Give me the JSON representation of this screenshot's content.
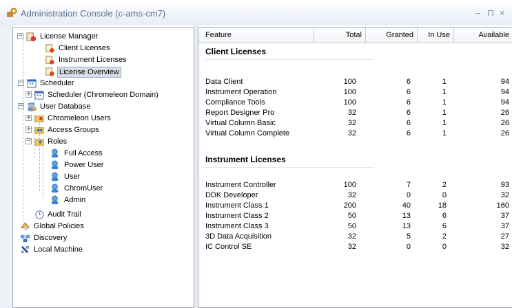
{
  "window": {
    "title": "Administration Console (c-ams-cm7)",
    "controls": {
      "minimize": "–",
      "restore": "⊓",
      "close": "×"
    }
  },
  "tree": [
    {
      "label": "License Manager",
      "icon": "license-manager-icon",
      "expander": "−"
    },
    {
      "label": "Client Licenses",
      "icon": "license-icon"
    },
    {
      "label": "Instrument Licenses",
      "icon": "license-icon"
    },
    {
      "label": "License Overview",
      "icon": "license-icon",
      "selected": true
    },
    {
      "label": "Scheduler",
      "icon": "scheduler-icon",
      "expander": "−"
    },
    {
      "label": "Scheduler (Chromeleon Domain)",
      "icon": "scheduler-icon",
      "expander": "+"
    },
    {
      "label": "User Database",
      "icon": "user-database-icon",
      "expander": "−"
    },
    {
      "label": "Chromeleon Users",
      "icon": "users-folder-icon",
      "expander": "+"
    },
    {
      "label": "Access Groups",
      "icon": "groups-folder-icon",
      "expander": "+"
    },
    {
      "label": "Roles",
      "icon": "roles-folder-icon",
      "expander": "−"
    },
    {
      "label": "Full Access",
      "icon": "role-icon"
    },
    {
      "label": "Power User",
      "icon": "role-icon"
    },
    {
      "label": "User",
      "icon": "role-icon"
    },
    {
      "label": "ChromUser",
      "icon": "role-icon"
    },
    {
      "label": "Admin",
      "icon": "role-icon"
    },
    {
      "label": "Audit Trail",
      "icon": "audit-trail-icon"
    },
    {
      "label": "Global Policies",
      "icon": "global-policies-icon"
    },
    {
      "label": "Discovery",
      "icon": "discovery-icon"
    },
    {
      "label": "Local Machine",
      "icon": "local-machine-icon"
    }
  ],
  "table": {
    "columns": [
      "Feature",
      "Total",
      "Granted",
      "In Use",
      "Available"
    ],
    "groups": [
      {
        "name": "Client Licenses",
        "rows": [
          [
            "Data Client",
            "100",
            "6",
            "1",
            "94"
          ],
          [
            "Instrument Operation",
            "100",
            "6",
            "1",
            "94"
          ],
          [
            "Compliance Tools",
            "100",
            "6",
            "1",
            "94"
          ],
          [
            "Report Designer Pro",
            "32",
            "6",
            "1",
            "26"
          ],
          [
            "Virtual Column Basic",
            "32",
            "6",
            "1",
            "26"
          ],
          [
            "Virtual Column Complete",
            "32",
            "6",
            "1",
            "26"
          ]
        ]
      },
      {
        "name": "Instrument Licenses",
        "rows": [
          [
            "Instrument Controller",
            "100",
            "7",
            "2",
            "93"
          ],
          [
            "DDK Developer",
            "32",
            "0",
            "0",
            "32"
          ],
          [
            "Instrument Class 1",
            "200",
            "40",
            "18",
            "160"
          ],
          [
            "Instrument Class 2",
            "50",
            "13",
            "6",
            "37"
          ],
          [
            "Instrument Class 3",
            "50",
            "13",
            "6",
            "37"
          ],
          [
            "3D Data Acquisition",
            "32",
            "5",
            "2",
            "27"
          ],
          [
            "IC Control SE",
            "32",
            "0",
            "0",
            "32"
          ]
        ]
      }
    ]
  }
}
